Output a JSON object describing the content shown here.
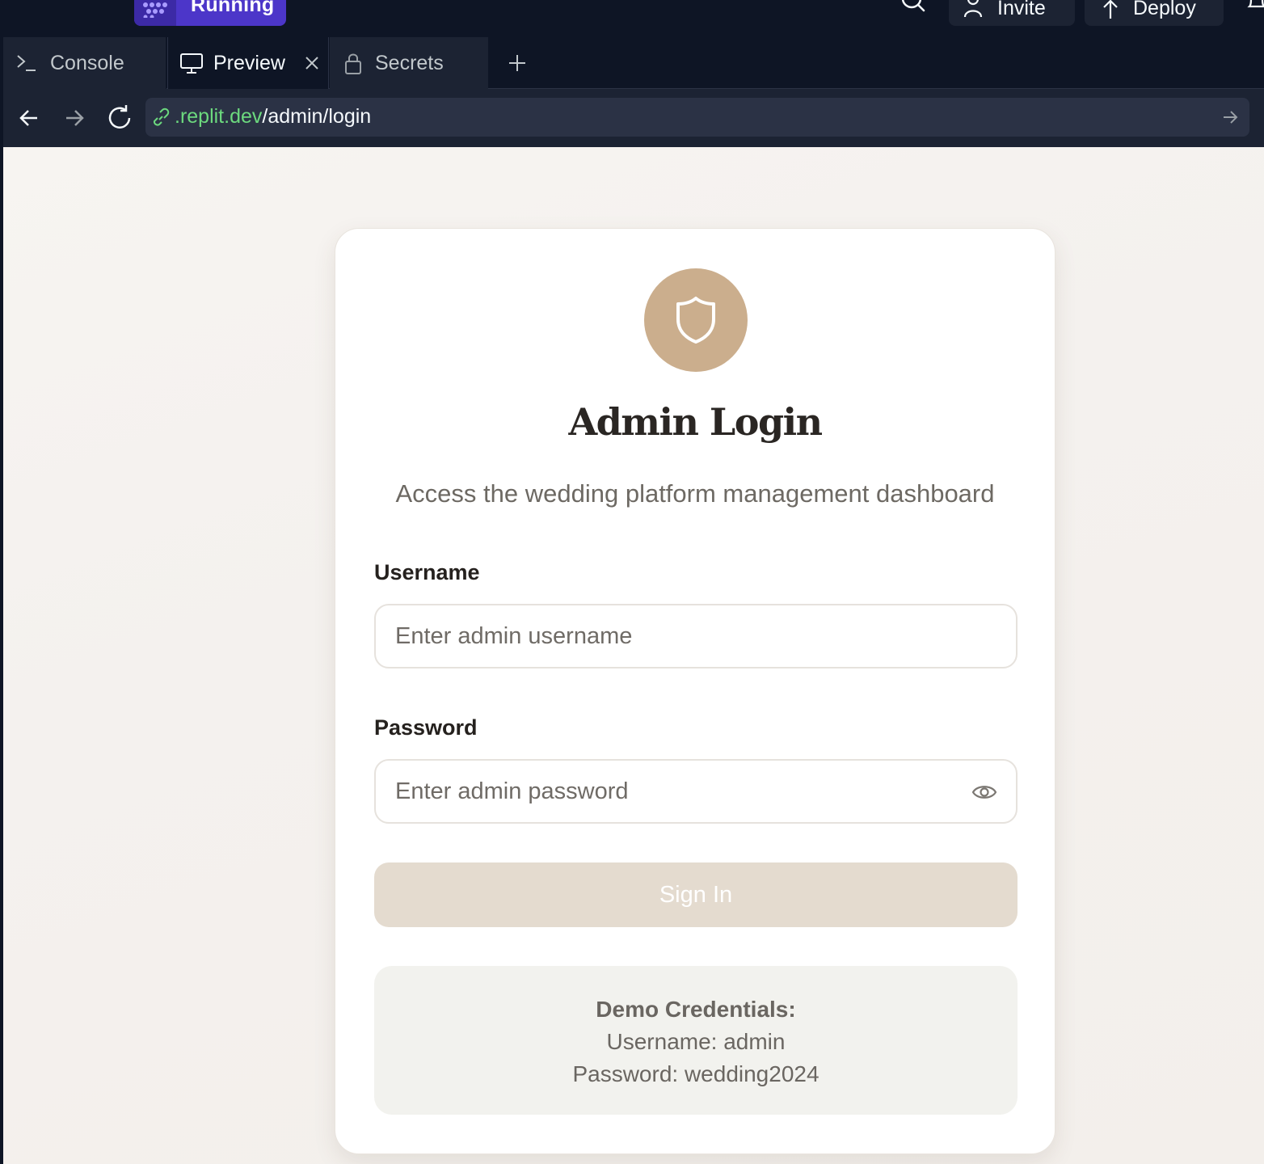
{
  "header": {
    "run_label": "Running",
    "invite_label": "Invite",
    "deploy_label": "Deploy"
  },
  "tabs": [
    {
      "label": "Console",
      "icon": "terminal-icon"
    },
    {
      "label": "Preview",
      "icon": "monitor-icon",
      "active": true
    },
    {
      "label": "Secrets",
      "icon": "lock-icon"
    }
  ],
  "address_bar": {
    "domain": ".replit.dev",
    "path": "/admin/login"
  },
  "login": {
    "title": "Admin Login",
    "subtitle": "Access the wedding platform management dashboard",
    "username_label": "Username",
    "username_placeholder": "Enter admin username",
    "password_label": "Password",
    "password_placeholder": "Enter admin password",
    "signin_label": "Sign In",
    "demo_heading": "Demo Credentials:",
    "demo_username": "Username: admin",
    "demo_password": "Password: wedding2024"
  },
  "colors": {
    "accent_badge": "#cbae8d",
    "signin_disabled": "#e4dbcf",
    "run_purple": "#4c36c9",
    "url_domain_green": "#6cd97e"
  }
}
